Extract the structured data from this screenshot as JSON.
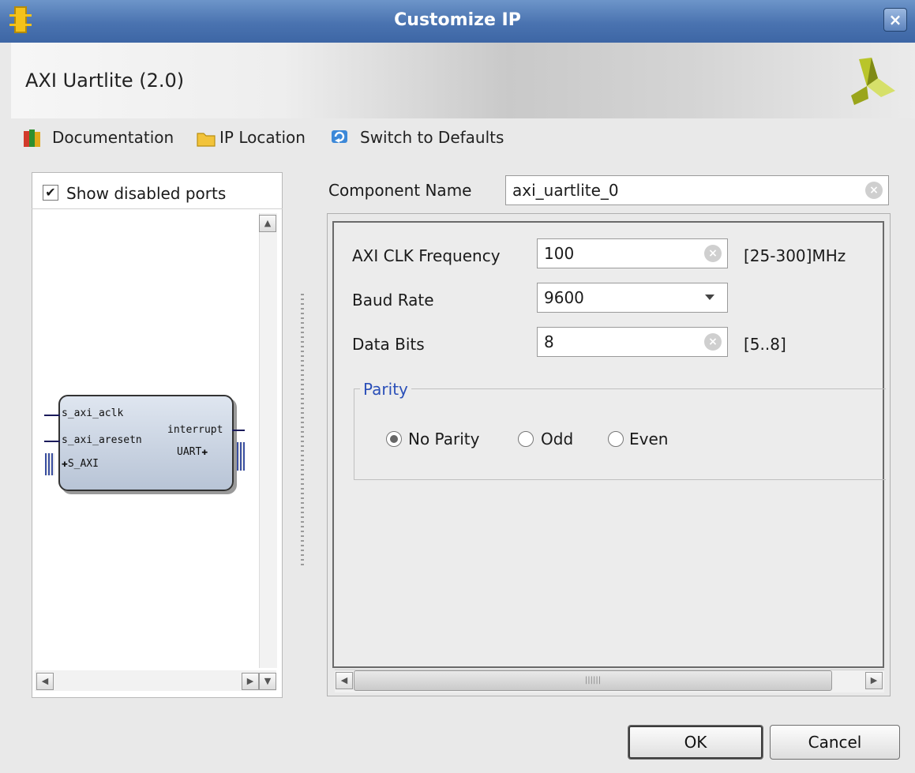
{
  "window": {
    "title": "Customize IP",
    "close_glyph": "×"
  },
  "header": {
    "ip_title": "AXI Uartlite (2.0)"
  },
  "toolbar": {
    "documentation": "Documentation",
    "ip_location": "IP Location",
    "switch_defaults": "Switch to Defaults"
  },
  "left_panel": {
    "show_disabled_ports": {
      "label": "Show disabled ports",
      "checked": true,
      "glyph": "✔"
    },
    "block": {
      "left_ports": [
        "s_axi_aclk",
        "s_axi_aresetn",
        "S_AXI"
      ],
      "right_ports": [
        "interrupt",
        "UART"
      ]
    }
  },
  "component": {
    "label": "Component Name",
    "value": "axi_uartlite_0"
  },
  "params": {
    "axi_clk": {
      "label": "AXI CLK Frequency",
      "value": "100",
      "range": "[25-300]MHz"
    },
    "baud_rate": {
      "label": "Baud Rate",
      "value": "9600",
      "options_selected": "9600"
    },
    "data_bits": {
      "label": "Data Bits",
      "value": "8",
      "range": "[5..8]"
    },
    "parity": {
      "title": "Parity",
      "options": [
        "No Parity",
        "Odd",
        "Even"
      ],
      "selected": "No Parity"
    }
  },
  "buttons": {
    "ok": "OK",
    "cancel": "Cancel"
  },
  "colors": {
    "titlebar": "#4a73b0",
    "accent_text": "#2a4fb8",
    "block_fill": "#c8d2e0"
  },
  "icons": {
    "close": "close-icon",
    "docs": "book-icon",
    "folder": "folder-icon",
    "refresh": "refresh-icon",
    "logo": "xilinx-logo",
    "clear": "clear-icon",
    "dropdown": "chevron-down-icon"
  }
}
